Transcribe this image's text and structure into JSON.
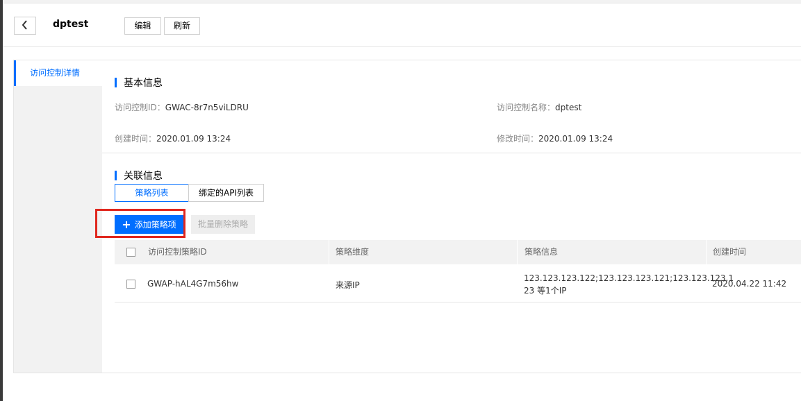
{
  "header": {
    "title": "dptest",
    "edit_label": "编辑",
    "refresh_label": "刷新"
  },
  "sidebar": {
    "items": [
      {
        "label": "访问控制详情"
      }
    ]
  },
  "basic_info": {
    "title": "基本信息",
    "id_label": "访问控制ID：",
    "id_value": "GWAC-8r7n5viLDRU",
    "name_label": "访问控制名称：",
    "name_value": "dptest",
    "created_label": "创建时间：",
    "created_value": "2020.01.09 13:24",
    "modified_label": "修改时间：",
    "modified_value": "2020.01.09 13:24"
  },
  "related_info": {
    "title": "关联信息",
    "tabs": [
      {
        "label": "策略列表"
      },
      {
        "label": "绑定的API列表"
      }
    ],
    "add_label": "添加策略项",
    "delete_label": "批量删除策略"
  },
  "table": {
    "headers": [
      "访问控制策略ID",
      "策略维度",
      "策略信息",
      "创建时间"
    ],
    "rows": [
      {
        "id": "GWAP-hAL4G7m56hw",
        "dimension": "来源IP",
        "info_line1": "123.123.123.122;123.123.123.121;123.123.123.1",
        "info_line2": "23 等1个IP",
        "created": "2020.04.22 11:42"
      }
    ]
  },
  "colors": {
    "accent": "#006eff",
    "highlight": "#e0271e"
  }
}
